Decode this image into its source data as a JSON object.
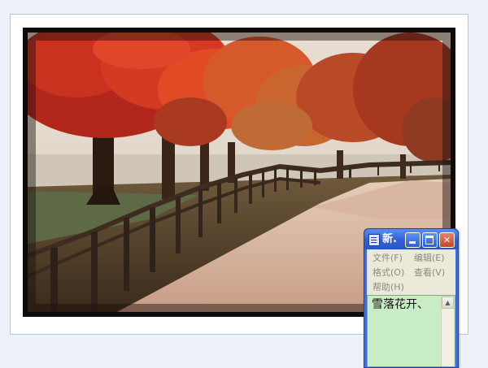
{
  "photo": {
    "subject": "autumn-tree-lined-path"
  },
  "notepad": {
    "title": "新.",
    "menus": [
      {
        "label": "文件",
        "key": "(F)"
      },
      {
        "label": "编辑",
        "key": "(E)"
      },
      {
        "label": "格式",
        "key": "(O)"
      },
      {
        "label": "查看",
        "key": "(V)"
      },
      {
        "label": "帮助",
        "key": "(H)"
      }
    ],
    "content": "雪落花开、",
    "icons": {
      "app": "notepad-icon",
      "minimize": "minimize-icon",
      "maximize": "maximize-icon",
      "close": "close-icon",
      "scroll_up": "scroll-up-arrow-icon"
    },
    "close_symbol": "✕",
    "scroll_up_symbol": "▲"
  },
  "colors": {
    "desktop": "#edf2f8",
    "title_bar": "#2f5fd6",
    "editor_background": "#c8ecc4",
    "menu_background": "#ece9d8"
  }
}
